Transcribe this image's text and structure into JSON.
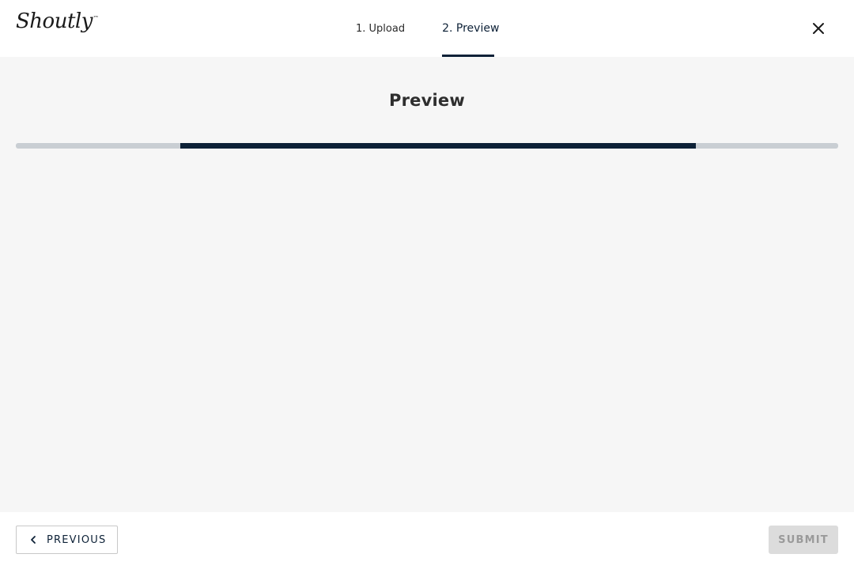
{
  "app": {
    "logo_text": "Shoutly",
    "logo_mark": "™"
  },
  "steps": [
    {
      "label": "1. Upload",
      "active": false
    },
    {
      "label": "2. Preview",
      "active": true
    }
  ],
  "header": {
    "close_icon": "close-icon"
  },
  "main": {
    "title": "Preview",
    "scroll": {
      "start": 0.2,
      "end": 0.827
    }
  },
  "footer": {
    "previous_label": "PREVIOUS",
    "previous_icon": "chevron-left-icon",
    "submit_label": "SUBMIT",
    "submit_disabled": true
  },
  "colors": {
    "accent": "#0d2137",
    "track": "#c9ced3",
    "background": "#f6f6f6"
  }
}
